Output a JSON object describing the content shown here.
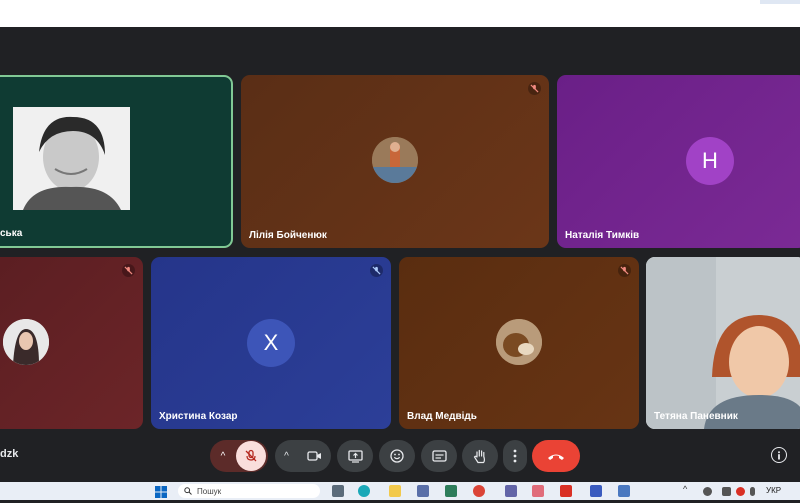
{
  "participants": {
    "p1": {
      "name": "ська"
    },
    "p2": {
      "name": "Лілія Бойченюк"
    },
    "p3": {
      "name": "Наталія Тимків",
      "initial": "Н"
    },
    "p4": {
      "name": ""
    },
    "p5": {
      "name": "Христина Козар",
      "initial": "Х"
    },
    "p6": {
      "name": "Влад Медвідь"
    },
    "p7": {
      "name": "Тетяна Паневник"
    }
  },
  "meeting": {
    "code_fragment": "dzk"
  },
  "taskbar": {
    "search_placeholder": "Пошук",
    "language": "УКР"
  },
  "colors": {
    "active_speaker_border": "#81c995",
    "leave_button": "#ea4335",
    "mic_muted": "#f28b82"
  }
}
